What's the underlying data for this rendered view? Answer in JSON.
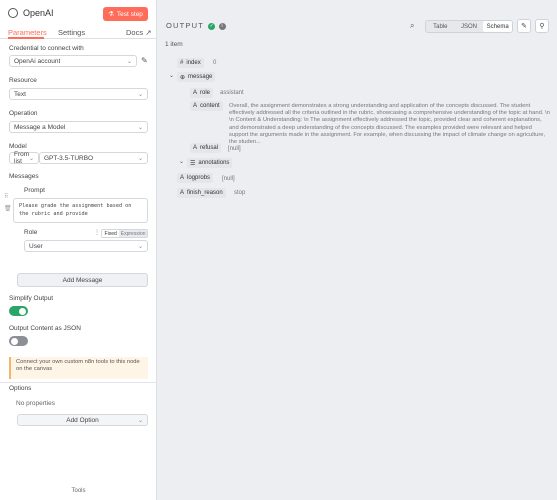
{
  "header": {
    "title": "OpenAI",
    "test_step": "Test step"
  },
  "tabs": {
    "parameters": "Parameters",
    "settings": "Settings",
    "docs": "Docs"
  },
  "credential": {
    "label": "Credential to connect with",
    "value": "OpenAi account"
  },
  "resource": {
    "label": "Resource",
    "value": "Text"
  },
  "operation": {
    "label": "Operation",
    "value": "Message a Model"
  },
  "model": {
    "label": "Model",
    "mode": "From list",
    "value": "GPT-3.5-TURBO"
  },
  "messages": {
    "label": "Messages",
    "prompt_label": "Prompt",
    "prompt_value": "Please grade the assignment based on the rubric and provide",
    "role_label": "Role",
    "role_fixed": "Fixed",
    "role_expression": "Expression",
    "role_value": "User",
    "add_message": "Add Message"
  },
  "simplify": {
    "label": "Simplify Output"
  },
  "json_out": {
    "label": "Output Content as JSON"
  },
  "notice": "Connect your own custom n8n tools to this node on the canvas",
  "options": {
    "label": "Options",
    "none": "No properties",
    "add": "Add Option"
  },
  "footer": "Tools",
  "output": {
    "title": "OUTPUT",
    "count": "1 item",
    "views": [
      "Table",
      "JSON",
      "Schema"
    ],
    "fields": {
      "index": "index",
      "index_val": "0",
      "message": "message",
      "role": "role",
      "role_val": "assistant",
      "content": "content",
      "content_val": "Overall, the assignment demonstrates a strong understanding and application of the concepts discussed. The student effectively addressed all the criteria outlined in the rubric, showcasing a comprehensive understanding of the topic at hand. \\n \\n Content & Understanding: \\n The assignment effectively addressed the topic, provided clear and coherent explanations, and demonstrated a deep understanding of the concepts discussed. The examples provided were relevant and helped support the arguments made in the assignment. For example, when discussing the impact of climate change on agriculture, the studen...",
      "refusal": "refusal",
      "refusal_val": "[null]",
      "annotations": "annotations",
      "logprobs": "logprobs",
      "logprobs_val": "[null]",
      "finish_reason": "finish_reason",
      "finish_reason_val": "stop"
    }
  },
  "colors": {
    "accent": "#ff6d5a",
    "success": "#29a568",
    "toggle_off": "#8c8f96"
  }
}
